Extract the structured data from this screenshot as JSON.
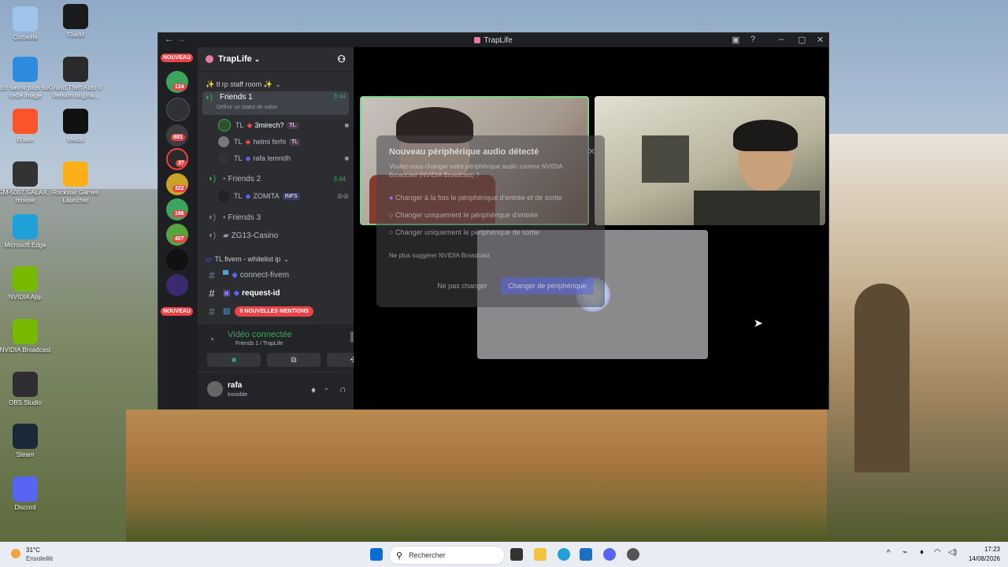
{
  "desktop": {
    "icons_left": [
      {
        "label": "Corbeille",
        "icon": "recycle-bin-icon",
        "color": "#9fc6ea"
      },
      {
        "label": "En savoir plus sur cette image",
        "icon": "info-image-icon",
        "color": "#2f8be0"
      },
      {
        "label": "Brave",
        "icon": "brave-icon",
        "color": "#fb542b"
      },
      {
        "label": "GM-5007 GALAX... mouse",
        "icon": "mouse-icon",
        "color": "#333333"
      },
      {
        "label": "Microsoft Edge",
        "icon": "edge-icon",
        "color": "#1fa0d8"
      },
      {
        "label": "NVIDIA App",
        "icon": "nvidia-icon",
        "color": "#76b900"
      },
      {
        "label": "NVIDIA Broadcast",
        "icon": "nvidia-broadcast-icon",
        "color": "#76b900"
      },
      {
        "label": "OBS Studio",
        "icon": "obs-icon",
        "color": "#302e31"
      },
      {
        "label": "Steam",
        "icon": "steam-icon",
        "color": "#1b2838"
      },
      {
        "label": "Discord",
        "icon": "discord-icon",
        "color": "#5865f2"
      }
    ],
    "icons_right": [
      {
        "label": "FiveM",
        "icon": "fivem-icon",
        "color": "#1b1b1b"
      },
      {
        "label": "Grand Theft Auto V Version origina...",
        "icon": "gta-icon",
        "color": "#2a2a2a"
      },
      {
        "label": "Medal",
        "icon": "medal-icon",
        "color": "#111111"
      },
      {
        "label": "Rockstar Games Launcher",
        "icon": "rockstar-icon",
        "color": "#fcaf17"
      }
    ]
  },
  "window": {
    "title": "TrapLife"
  },
  "rail": {
    "badges": [
      "124",
      "683",
      "37",
      "322",
      "196",
      "407"
    ],
    "new_label": "NOUVEAU",
    "new_label_bottom": "NOUVEAU"
  },
  "server": {
    "name": "TrapLife",
    "category1": "✨ tl rp staff room ✨",
    "voice1": {
      "name": "Friends 1",
      "time": "3:44",
      "status_placeholder": "Définir un statut de salon"
    },
    "members": [
      {
        "prefix": "TL",
        "name": "3mirech?",
        "tag": "TL"
      },
      {
        "prefix": "TL",
        "name": "helmi ferhi",
        "tag": "TL"
      },
      {
        "prefix": "TL",
        "name": "rafa lemridh",
        "tag": ""
      }
    ],
    "voice2": {
      "name": "Friends 2",
      "time": "3:44"
    },
    "voice2_member": {
      "prefix": "TL",
      "name": "ZOMITA",
      "tag": "INFS"
    },
    "voice3": {
      "name": "Friends 3"
    },
    "voice4": {
      "name": "ZG13-Casino"
    },
    "category2": "TL fivem - whitelist ip",
    "text1": "connect-fivem",
    "text2": "request-id",
    "mentions": "8 NOUVELLES MENTIONS"
  },
  "voice_panel": {
    "status": "Vidéo connectée",
    "location": "Friends 1 / TrapLife"
  },
  "user": {
    "name": "rafa",
    "status": "Invisible"
  },
  "dialog": {
    "title": "Nouveau périphérique audio détecté",
    "body": "Voulez-vous changer votre périphérique audio comme NVIDIA Broadcast (NVIDIA Broadcast) ?",
    "option1": "Changer à la fois le périphérique d'entrée et de sortie",
    "option2": "Changer uniquement le périphérique d'entrée",
    "option3": "Changer uniquement le périphérique de sortie",
    "dont_ask": "Ne plus suggérer NVIDIA Broadcast",
    "cancel": "Ne pas changer",
    "confirm": "Changer de périphérique"
  },
  "taskbar": {
    "weather_temp": "31°C",
    "weather_desc": "Ensoleillé",
    "search_placeholder": "Rechercher",
    "time": "17:23",
    "date": "14/08/2026"
  },
  "colors": {
    "discord_red": "#ed4245",
    "speaking_green": "#7bd389",
    "blurple": "#5865f2"
  }
}
